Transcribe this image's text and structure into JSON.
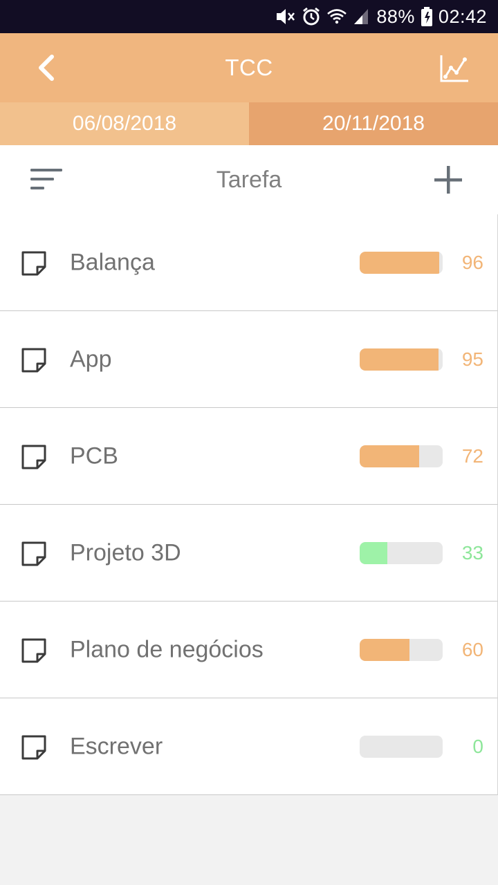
{
  "status_bar": {
    "battery": "88%",
    "time": "02:42"
  },
  "app_bar": {
    "title": "TCC",
    "back_icon": "chevron-left-icon",
    "chart_icon": "line-chart-icon"
  },
  "dates": {
    "start": "06/08/2018",
    "end": "20/11/2018"
  },
  "toolbar": {
    "title": "Tarefa",
    "sort_icon": "sort-icon",
    "add_icon": "plus-icon"
  },
  "colors": {
    "accent_orange": "#f0b67f",
    "bar_orange": "#f2b577",
    "bar_green": "#9ef2a8",
    "text_green": "#8ee69a"
  },
  "tasks": [
    {
      "name": "Balança",
      "percent": "96",
      "progress": 0.96,
      "color": "orange"
    },
    {
      "name": "App",
      "percent": "95",
      "progress": 0.95,
      "color": "orange"
    },
    {
      "name": "PCB",
      "percent": "72",
      "progress": 0.72,
      "color": "orange"
    },
    {
      "name": "Projeto 3D",
      "percent": "33",
      "progress": 0.33,
      "color": "green"
    },
    {
      "name": "Plano de negócios",
      "percent": "60",
      "progress": 0.6,
      "color": "orange"
    },
    {
      "name": "Escrever",
      "percent": "0",
      "progress": 0.0,
      "color": "green"
    }
  ]
}
